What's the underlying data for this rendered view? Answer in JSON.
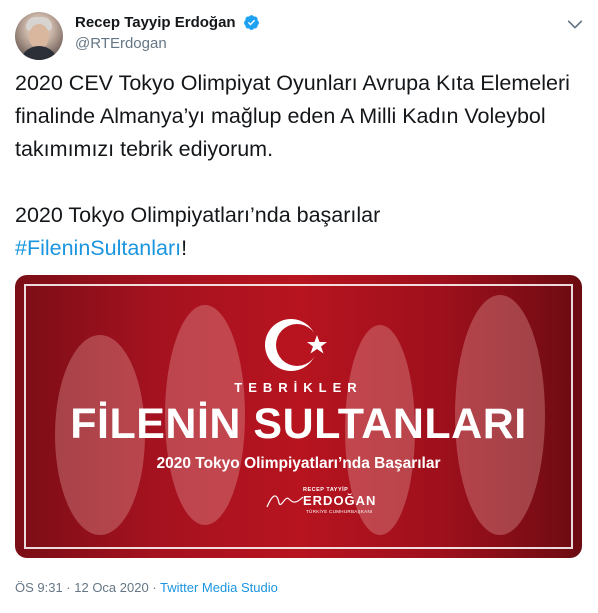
{
  "tweet": {
    "author": {
      "display_name": "Recep Tayyip Erdoğan",
      "handle": "@RTErdogan",
      "verified_icon": "verified-badge-icon"
    },
    "text_line1": "2020 CEV Tokyo Olimpiyat Oyunları Avrupa Kıta Elemeleri finalinde Almanya’yı mağlup eden A Milli Kadın Voleybol takımımızı tebrik ediyorum.",
    "text_line2": "2020 Tokyo Olimpiyatları’nda başarılar",
    "hashtag": "#FileninSultanları",
    "hashtag_suffix": "!",
    "media": {
      "kicker": "TEBRİKLER",
      "headline": "FİLENİN SULTANLARI",
      "subline": "2020 Tokyo Olimpiyatları’nda Başarılar",
      "signature_top": "RECEP TAYYİP",
      "signature_name": "ERDOĞAN",
      "signature_title": "TÜRKİYE CUMHURBAŞKANI"
    },
    "timestamp": "ÖS 9:31 · 12 Oca 2020",
    "separator": " · ",
    "source": "Twitter Media Studio"
  },
  "colors": {
    "link": "#1b95e0",
    "muted": "#657786",
    "media_red": "#b7141f"
  }
}
